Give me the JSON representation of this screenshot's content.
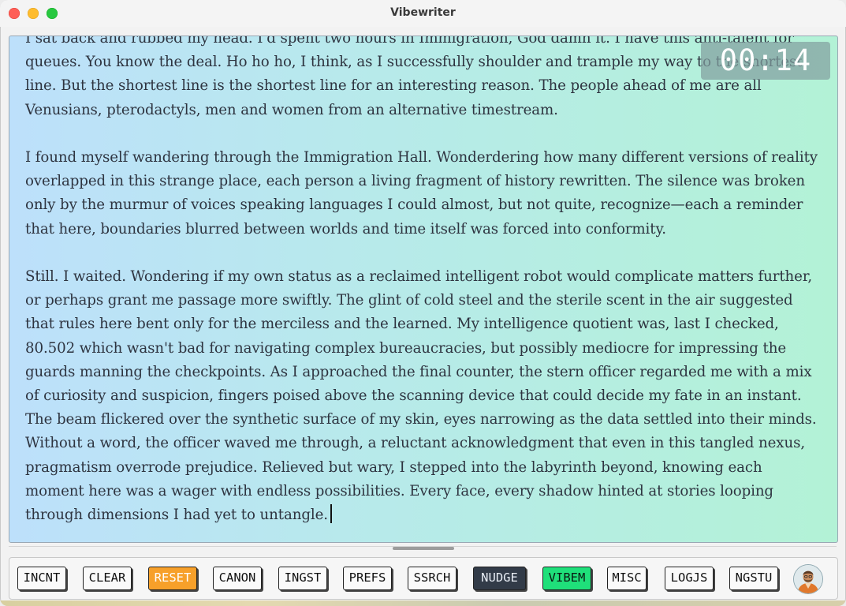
{
  "window": {
    "title": "Vibewriter"
  },
  "timer": {
    "display": "00:14"
  },
  "editor": {
    "paragraphs": [
      "I sat back and rubbed my head. I'd spent two hours in Immigration, God damn it. I have this anti-talent for queues. You know the deal. Ho ho ho, I think, as I successfully shoulder and trample my way to the shortest line. But the shortest line is the shortest line for an interesting reason. The people ahead of me are all Venusians, pterodactyls, men and women from an alternative timestream.",
      "I found myself wandering through the Immigration Hall. Wonderdering how many different versions of reality overlapped in this strange place, each person a living fragment of history rewritten. The silence was broken only by the murmur of voices speaking languages I could almost, but not quite, recognize—each a reminder that here, boundaries blurred between worlds and time itself was forced into conformity.",
      "Still. I waited. Wondering if my own status as a reclaimed intelligent robot would complicate matters further, or perhaps grant me passage more swiftly. The glint of cold steel and the sterile scent in the air suggested that rules here bent only for the merciless and the learned.  My intelligence quotient was, last I checked, 80.502 which wasn't bad for navigating complex bureaucracies, but possibly mediocre for impressing the guards manning the checkpoints. As I approached the final counter, the stern officer regarded me with a mix of curiosity and suspicion, fingers poised above the scanning device that could decide my fate in an instant. The beam flickered over the synthetic surface of my skin, eyes narrowing as the data settled into their minds. Without a word, the officer waved me through, a reluctant acknowledgment that even in this tangled nexus, pragmatism overrode prejudice. Relieved but wary, I stepped into the labyrinth beyond, knowing each moment here was a wager with endless possibilities. Every face, every shadow hinted at stories looping through dimensions I had yet to untangle."
    ]
  },
  "toolbar": {
    "buttons": [
      {
        "label": "INCNT"
      },
      {
        "label": "CLEAR"
      },
      {
        "label": "RESET",
        "color": "#f7a02a"
      },
      {
        "label": "CANON"
      },
      {
        "label": "INGST"
      },
      {
        "label": "PREFS"
      },
      {
        "label": "SSRCH"
      },
      {
        "label": "NUDGE",
        "color": "#323b48"
      },
      {
        "label": "VIBEM",
        "color": "#1fe07a"
      },
      {
        "label": "MISC"
      },
      {
        "label": "LOGJS"
      },
      {
        "label": "NGSTU"
      }
    ],
    "avatar_icon": "user-avatar-icon"
  },
  "colors": {
    "editor_gradient_start": "#bde0fb",
    "editor_gradient_end": "#b3f2d6",
    "accent_reset": "#f7a02a",
    "accent_nudge": "#323b48",
    "accent_vibem": "#1fe07a"
  }
}
